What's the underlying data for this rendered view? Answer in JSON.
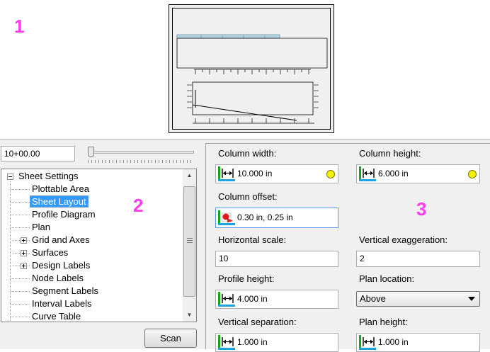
{
  "markers": {
    "m1": "1",
    "m2": "2",
    "m3": "3"
  },
  "station": {
    "value": "10+00.00"
  },
  "slider": {
    "level": 0
  },
  "tree": {
    "items": [
      {
        "label": "Sheet Settings"
      },
      {
        "label": "Plottable Area"
      },
      {
        "label": "Sheet Layout"
      },
      {
        "label": "Profile Diagram"
      },
      {
        "label": "Plan"
      },
      {
        "label": "Grid and Axes"
      },
      {
        "label": "Surfaces"
      },
      {
        "label": "Design Labels"
      },
      {
        "label": "Node Labels"
      },
      {
        "label": "Segment Labels"
      },
      {
        "label": "Interval Labels"
      },
      {
        "label": "Curve Table"
      }
    ],
    "selected": "Sheet Layout"
  },
  "scan": {
    "label": "Scan"
  },
  "props": {
    "column_width": {
      "label": "Column width:",
      "value": "10.000 in"
    },
    "column_height": {
      "label": "Column height:",
      "value": "6.000 in"
    },
    "column_offset": {
      "label": "Column offset:",
      "value": "0.30 in, 0.25 in"
    },
    "horizontal_scale": {
      "label": "Horizontal scale:",
      "value": "10"
    },
    "vertical_exaggeration": {
      "label": "Vertical exaggeration:",
      "value": "2"
    },
    "profile_height": {
      "label": "Profile height:",
      "value": "4.000 in"
    },
    "plan_location": {
      "label": "Plan location:",
      "value": "Above"
    },
    "vertical_separation": {
      "label": "Vertical separation:",
      "value": "1.000 in"
    },
    "plan_height": {
      "label": "Plan height:",
      "value": "1.000 in"
    }
  },
  "colors": {
    "marker": "#ff3cf0",
    "selection": "#3399ff",
    "status_dot": "#f4f000"
  }
}
